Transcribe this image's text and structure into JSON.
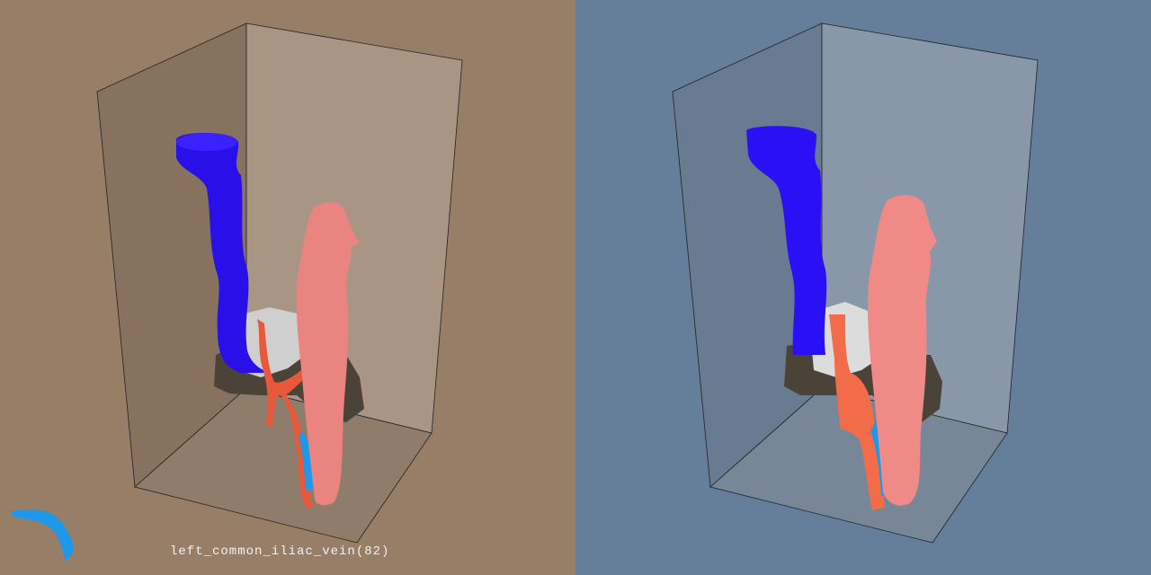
{
  "viewer": {
    "left": {
      "background": "#977f67",
      "selected_label": "left_common_iliac_vein(82)",
      "style": "surface"
    },
    "right": {
      "background": "#657e99",
      "style": "voxel"
    }
  },
  "structures": [
    {
      "name": "inferior_vena_cava",
      "color": "#2a10f0"
    },
    {
      "name": "aorta",
      "color": "#ea7f7c"
    },
    {
      "name": "iliac_arteries",
      "color": "#e8583a"
    },
    {
      "name": "left_common_iliac_vein",
      "color": "#1e98e8"
    },
    {
      "name": "bone",
      "color": "#d8d8d8"
    },
    {
      "name": "soft_tissue",
      "color": "#4a4236"
    }
  ]
}
